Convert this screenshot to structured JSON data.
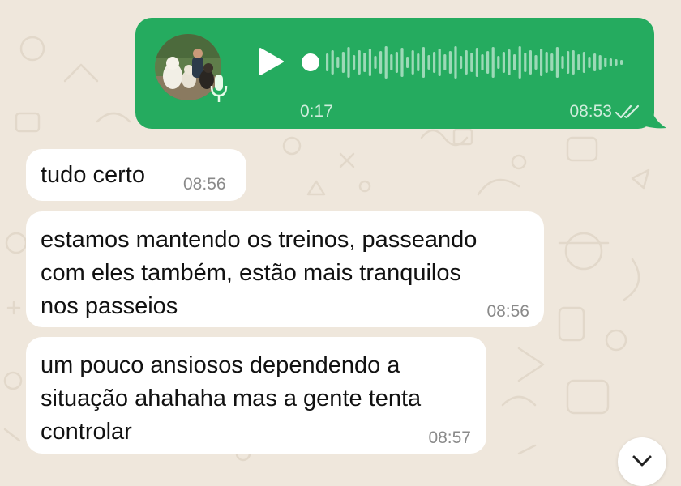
{
  "voice_message": {
    "duration": "0:17",
    "time": "08:53",
    "status_icon": "double-check-icon",
    "play_icon": "play-icon",
    "mic_icon": "microphone-icon"
  },
  "messages": [
    {
      "text": "tudo certo",
      "time": "08:56"
    },
    {
      "lines": [
        "estamos mantendo os treinos, passeando",
        "com eles também, estão mais tranquilos",
        "nos passeios"
      ],
      "time": "08:56"
    },
    {
      "lines": [
        "um pouco ansiosos dependendo a",
        "situação ahahaha mas a gente tenta",
        "controlar"
      ],
      "time": "08:57"
    }
  ],
  "colors": {
    "outgoing_bubble": "#25ab5f",
    "incoming_bubble": "#ffffff",
    "background": "#efe7dc"
  },
  "scroll_button_icon": "chevron-down-icon"
}
